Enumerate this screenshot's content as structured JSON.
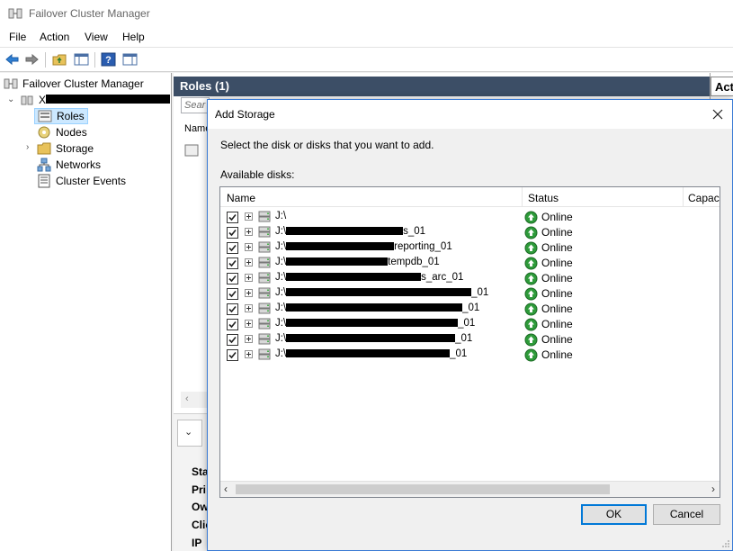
{
  "window": {
    "title": "Failover Cluster Manager"
  },
  "menu": {
    "file": "File",
    "action": "Action",
    "view": "View",
    "help": "Help"
  },
  "tree": {
    "root": "Failover Cluster Manager",
    "cluster_prefix": "X",
    "items": [
      {
        "label": "Roles",
        "icon": "roles-icon"
      },
      {
        "label": "Nodes",
        "icon": "nodes-icon"
      },
      {
        "label": "Storage",
        "icon": "storage-folder-icon"
      },
      {
        "label": "Networks",
        "icon": "networks-icon"
      },
      {
        "label": "Cluster Events",
        "icon": "cluster-events-icon"
      }
    ]
  },
  "middle": {
    "header": "Roles (1)",
    "search_placeholder": "Sear",
    "column": "Name",
    "lower_labels": [
      "Sta",
      "Pri",
      "Ow",
      "Clie",
      "IP"
    ]
  },
  "actions": {
    "header": "Actions"
  },
  "dialog": {
    "title": "Add Storage",
    "instruction": "Select the disk or disks that you want to add.",
    "available_label": "Available disks:",
    "columns": {
      "name": "Name",
      "status": "Status",
      "capacity": "Capaci"
    },
    "disks": [
      {
        "prefix": "J:\\",
        "suffix": "",
        "status": "Online"
      },
      {
        "prefix": "J:\\",
        "suffix": "s_01",
        "status": "Online"
      },
      {
        "prefix": "J:\\",
        "suffix": "reporting_01",
        "status": "Online"
      },
      {
        "prefix": "J:\\",
        "suffix": "tempdb_01",
        "status": "Online"
      },
      {
        "prefix": "J:\\",
        "suffix": "s_arc_01",
        "status": "Online"
      },
      {
        "prefix": "J:\\",
        "suffix": "_01",
        "status": "Online"
      },
      {
        "prefix": "J:\\",
        "suffix": "_01",
        "status": "Online"
      },
      {
        "prefix": "J:\\",
        "suffix": "_01",
        "status": "Online"
      },
      {
        "prefix": "J:\\",
        "suffix": "_01",
        "status": "Online"
      },
      {
        "prefix": "J:\\",
        "suffix": "_01",
        "status": "Online"
      }
    ],
    "ok_label": "OK",
    "cancel_label": "Cancel"
  },
  "colors": {
    "mid_header_bg": "#3c4e66",
    "selection_bg": "#cce8ff",
    "dialog_border": "#3a7bd5",
    "status_green": "#2e9b3a"
  }
}
